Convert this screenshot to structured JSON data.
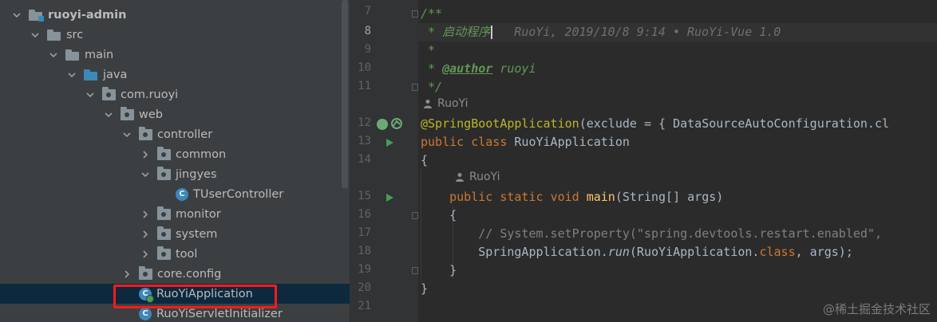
{
  "tree": {
    "items": [
      {
        "label": "ruoyi-admin",
        "depth": 0,
        "expanded": true,
        "icon": "module-folder-icon",
        "bold": true
      },
      {
        "label": "src",
        "depth": 1,
        "expanded": true,
        "icon": "folder-icon"
      },
      {
        "label": "main",
        "depth": 2,
        "expanded": true,
        "icon": "folder-icon"
      },
      {
        "label": "java",
        "depth": 3,
        "expanded": true,
        "icon": "source-root-folder-icon"
      },
      {
        "label": "com.ruoyi",
        "depth": 4,
        "expanded": true,
        "icon": "package-icon"
      },
      {
        "label": "web",
        "depth": 5,
        "expanded": true,
        "icon": "package-icon"
      },
      {
        "label": "controller",
        "depth": 6,
        "expanded": true,
        "icon": "package-icon"
      },
      {
        "label": "common",
        "depth": 7,
        "expanded": false,
        "icon": "package-icon"
      },
      {
        "label": "jingyes",
        "depth": 7,
        "expanded": true,
        "icon": "package-icon"
      },
      {
        "label": "TUserController",
        "depth": 8,
        "icon": "class-icon"
      },
      {
        "label": "monitor",
        "depth": 7,
        "expanded": false,
        "icon": "package-icon"
      },
      {
        "label": "system",
        "depth": 7,
        "expanded": false,
        "icon": "package-icon"
      },
      {
        "label": "tool",
        "depth": 7,
        "expanded": false,
        "icon": "package-icon"
      },
      {
        "label": "core.config",
        "depth": 6,
        "expanded": false,
        "icon": "package-icon"
      },
      {
        "label": "RuoYiApplication",
        "depth": 6,
        "icon": "runnable-class-icon",
        "selected": true
      },
      {
        "label": "RuoYiServletInitializer",
        "depth": 6,
        "icon": "class-icon"
      }
    ]
  },
  "editor": {
    "current_line": 8,
    "blame": "RuoYi, 2019/10/8 9:14 • RuoYi-Vue 1.0",
    "lines": [
      {
        "num": "7",
        "text": "/**"
      },
      {
        "num": "8",
        "text": " * 启动程序"
      },
      {
        "num": "9",
        "text": " *"
      },
      {
        "num": "10",
        "text": " * @author ruoyi"
      },
      {
        "num": "11",
        "text": " */"
      },
      {
        "hint": "RuoYi"
      },
      {
        "num": "12",
        "text": "@SpringBootApplication(exclude = { DataSourceAutoConfiguration.cl"
      },
      {
        "num": "13",
        "text": "public class RuoYiApplication"
      },
      {
        "num": "14",
        "text": "{"
      },
      {
        "hint": "RuoYi"
      },
      {
        "num": "15",
        "text": "    public static void main(String[] args)"
      },
      {
        "num": "16",
        "text": "    {"
      },
      {
        "num": "17",
        "text": "        // System.setProperty(\"spring.devtools.restart.enabled\","
      },
      {
        "num": "18",
        "text": "        SpringApplication.run(RuoYiApplication.class, args);"
      },
      {
        "num": "19",
        "text": "    }"
      },
      {
        "num": "20",
        "text": "}"
      },
      {
        "num": "21",
        "text": ""
      }
    ],
    "tokens": {
      "doc_star": " * ",
      "doc_title": "启动程序",
      "author_tag": "@author",
      "author_name": " ruoyi",
      "annotation": "@SpringBootApplication",
      "exclude_rest": "(exclude = { DataSourceAutoConfiguration.cl",
      "kw_public": "public",
      "kw_class": "class",
      "class_name": " RuoYiApplication",
      "kw_static": "static",
      "kw_void": "void",
      "main_name": "main",
      "main_args": "(String[] args)",
      "comment17": "// System.setProperty(\"spring.devtools.restart.enabled\",",
      "call_obj": "SpringApplication.",
      "call_run": "run",
      "call_args_a": "(RuoYiApplication.",
      "call_class": "class",
      "call_args_b": ", args);"
    }
  },
  "watermark": "@稀土掘金技术社区",
  "colors": {
    "highlight_box": "#ff1a1a",
    "selection": "#0d293e"
  }
}
